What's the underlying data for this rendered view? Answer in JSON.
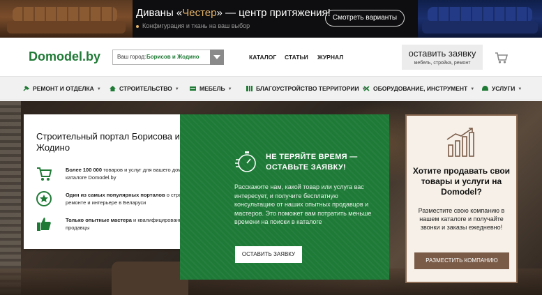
{
  "banner": {
    "title_prefix": "Диваны «",
    "title_accent": "Честер",
    "title_suffix": "» — центр притяжения!",
    "subtitle": "Конфигурация и ткань на ваш выбор",
    "button_label": "Смотреть варианты",
    "accent_color": "#e6b56a"
  },
  "header": {
    "logo": "Domodel.by",
    "city_label": "Ваш город:",
    "city_value": "Борисов и Жодино",
    "nav": [
      "КАТАЛОГ",
      "СТАТЬИ",
      "ЖУРНАЛ"
    ],
    "cta_title": "оставить заявку",
    "cta_subtitle": "мебель, стройка, ремонт",
    "brand_color": "#1f7a36"
  },
  "categories": [
    {
      "label": "РЕМОНТ И ОТДЕЛКА",
      "icon": "hammer-icon"
    },
    {
      "label": "СТРОИТЕЛЬСТВО",
      "icon": "house-icon"
    },
    {
      "label": "МЕБЕЛЬ",
      "icon": "furniture-icon"
    },
    {
      "label": "БЛАГОУСТРОЙСТВО ТЕРРИТОРИИ",
      "icon": "fence-icon"
    },
    {
      "label": "ОБОРУДОВАНИЕ, ИНСТРУМЕНТ",
      "icon": "tools-icon"
    },
    {
      "label": "УСЛУГИ",
      "icon": "helmet-icon"
    }
  ],
  "hero": {
    "left": {
      "title": "Строительный портал Борисова и Жодино",
      "features": [
        {
          "bold": "Более 100 000",
          "text": " товаров и услуг для вашего дома в удобном каталоге Domodel.by",
          "icon": "cart-icon"
        },
        {
          "bold": "Один из самых популярных порталов",
          "text": " о строительстве, ремонте и интерьере в Беларуси",
          "icon": "star-icon"
        },
        {
          "bold": "Только опытные мастера",
          "text": " и квалифицированные продавцы",
          "icon": "thumbs-up-icon"
        }
      ]
    },
    "middle": {
      "title": "НЕ ТЕРЯЙТЕ ВРЕМЯ — ОСТАВЬТЕ ЗАЯВКУ!",
      "text": "Расскажите нам, какой товар или услуга вас интересует, и получите бесплатную консультацию от наших опытных продавцов и мастеров. Это поможет вам потратить меньше времени на поиски в каталоге",
      "button_label": "ОСТАВИТЬ ЗАЯВКУ",
      "bg_color": "#1e7a37"
    },
    "right": {
      "title": "Хотите продавать свои товары и услуги на Domodel?",
      "text": "Разместите свою компанию в нашем каталоге и получайте звонки и заказы ежедневно!",
      "button_label": "РАЗМЕСТИТЬ КОМПАНИЮ",
      "button_color": "#7a5b47"
    }
  }
}
